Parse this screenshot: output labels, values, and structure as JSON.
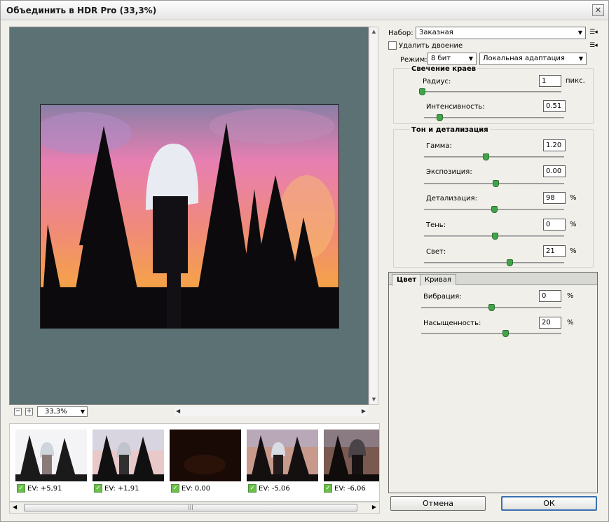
{
  "window": {
    "title": "Объединить в HDR Pro (33,3%)",
    "close_glyph": "✕"
  },
  "preview": {
    "zoom_out": "−",
    "zoom_in": "+",
    "zoom_value": "33,3%"
  },
  "filmstrip": {
    "items": [
      {
        "ev": "EV: +5,91",
        "checked": true
      },
      {
        "ev": "EV: +1,91",
        "checked": true
      },
      {
        "ev": "EV: 0,00",
        "checked": true
      },
      {
        "ev": "EV: -5,06",
        "checked": true
      },
      {
        "ev": "EV: -6,06",
        "checked": true
      }
    ]
  },
  "controls": {
    "preset_label": "Набор:",
    "preset_value": "Заказная",
    "remove_ghosts_label": "Удалить двоение",
    "mode_label": "Режим:",
    "bit_value": "8 бит",
    "method_value": "Локальная адаптация",
    "edge_glow": {
      "title": "Свечение краев",
      "radius_label": "Радиус:",
      "radius_value": "1",
      "radius_unit": "пикс.",
      "strength_label": "Интенсивность:",
      "strength_value": "0.51"
    },
    "tone_detail": {
      "title": "Тон и детализация",
      "gamma_label": "Гамма:",
      "gamma_value": "1.20",
      "exposure_label": "Экспозиция:",
      "exposure_value": "0.00",
      "detail_label": "Детализация:",
      "detail_value": "98",
      "detail_unit": "%",
      "shadow_label": "Тень:",
      "shadow_value": "0",
      "shadow_unit": "%",
      "highlight_label": "Свет:",
      "highlight_value": "21",
      "highlight_unit": "%"
    },
    "tabs": {
      "color_label": "Цвет",
      "curve_label": "Кривая"
    },
    "color": {
      "vibrance_label": "Вибрация:",
      "vibrance_value": "0",
      "vibrance_unit": "%",
      "saturation_label": "Насыщенность:",
      "saturation_value": "20",
      "saturation_unit": "%"
    }
  },
  "buttons": {
    "cancel": "Отмена",
    "ok": "ОК"
  }
}
